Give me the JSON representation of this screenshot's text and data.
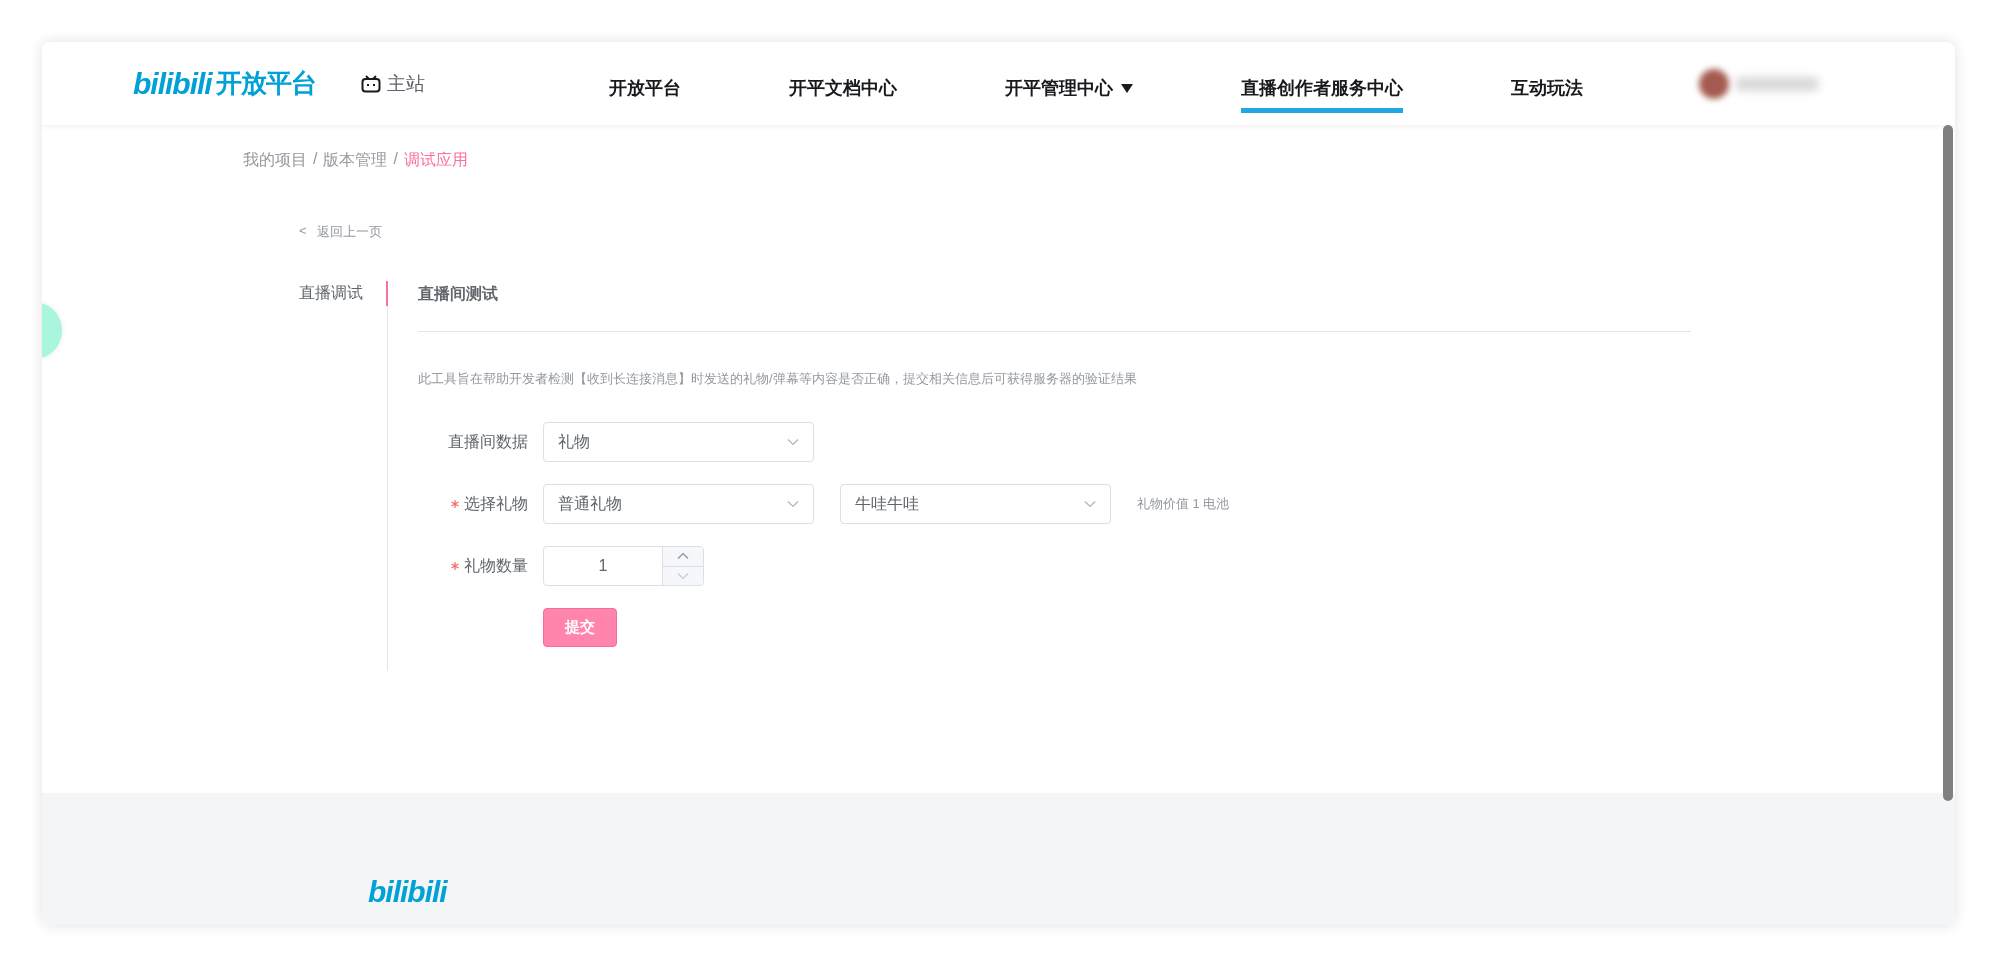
{
  "header": {
    "logo": {
      "mark": "bilibili",
      "text": "开放平台"
    },
    "home_link": "主站",
    "nav": [
      {
        "label": "开放平台",
        "selected": false,
        "dropdown": false
      },
      {
        "label": "开平文档中心",
        "selected": false,
        "dropdown": false
      },
      {
        "label": "开平管理中心",
        "selected": false,
        "dropdown": true
      },
      {
        "label": "直播创作者服务中心",
        "selected": true,
        "dropdown": false
      },
      {
        "label": "互动玩法",
        "selected": false,
        "dropdown": false
      }
    ]
  },
  "breadcrumb": [
    {
      "label": "我的项目",
      "selected": false
    },
    {
      "separator": "/",
      "label": "版本管理",
      "selected": false
    },
    {
      "separator": "/",
      "label": "调试应用",
      "selected": true
    }
  ],
  "back_link": {
    "arrow": "<",
    "label": "返回上一页"
  },
  "side_menu": [
    {
      "label": "直播调试",
      "selected": true
    }
  ],
  "section_title": "直播间测试",
  "description": "此工具旨在帮助开发者检测【收到长连接消息】时发送的礼物/弹幕等内容是否正确，提交相关信息后可获得服务器的验证结果",
  "form": {
    "rows": [
      {
        "kind": "select",
        "label": "直播间数据",
        "required": false,
        "selects": [
          {
            "value": "礼物"
          }
        ]
      },
      {
        "kind": "select",
        "label": "选择礼物",
        "required": true,
        "selects": [
          {
            "value": "普通礼物"
          },
          {
            "value": "牛哇牛哇"
          }
        ],
        "hint": "礼物价值 1 电池"
      },
      {
        "kind": "number",
        "label": "礼物数量",
        "required": true,
        "value": "1"
      }
    ],
    "submit": "提交"
  },
  "footer": {
    "logo": "bilibili"
  }
}
